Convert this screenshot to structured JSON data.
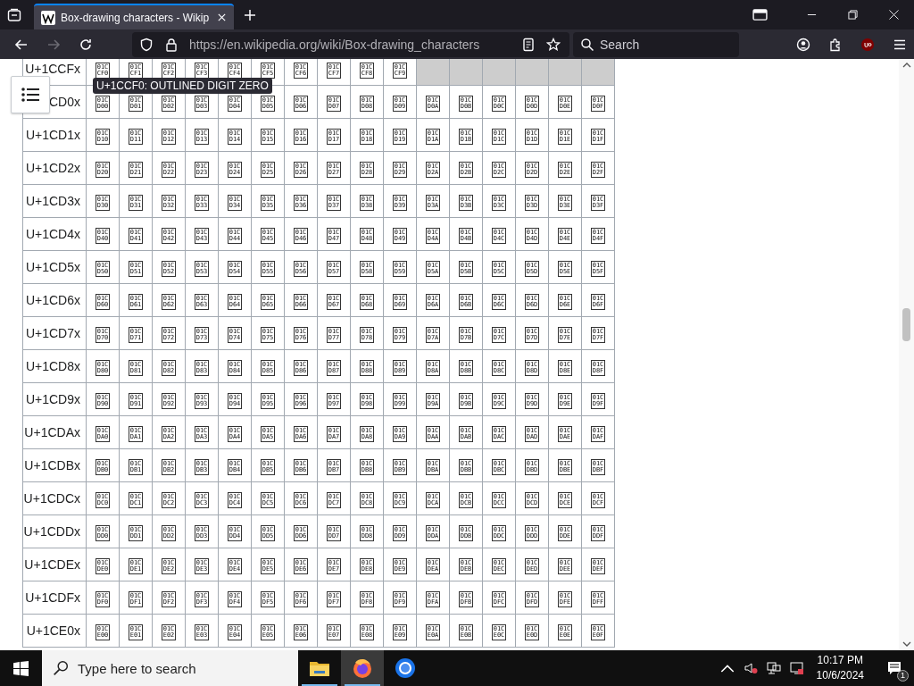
{
  "browser": {
    "tabs": [
      {
        "title": "Box-drawing characters - Wikip",
        "selected": true
      }
    ],
    "nav": [
      {
        "kind": "back",
        "disabled": false
      },
      {
        "kind": "forward",
        "disabled": true
      },
      {
        "kind": "reload",
        "disabled": false
      }
    ],
    "url": "https://en.wikipedia.org/wiki/Box-drawing_characters",
    "search": {
      "placeholder": "Search"
    }
  },
  "table": {
    "rows": [
      {
        "label": "U+1CCFx",
        "cells": [
          "01C\nCF0",
          "01C\nCF1",
          "01C\nCF2",
          "01C\nCF3",
          "01C\nCF4",
          "01C\nCF5",
          "01C\nCF6",
          "01C\nCF7",
          "01C\nCF8",
          "01C\nCF9",
          {
            "kind": "unassigned"
          },
          {
            "kind": "unassigned"
          },
          {
            "kind": "unassigned"
          },
          {
            "kind": "unassigned"
          },
          {
            "kind": "unassigned"
          },
          {
            "kind": "unassigned"
          }
        ]
      },
      {
        "label": "CD0x",
        "cells": [
          "01C\nD00",
          "01C\nD01",
          "01C\nD02",
          "01C\nD03",
          "01C\nD04",
          "01C\nD05",
          "01C\nD06",
          "01C\nD07",
          "01C\nD08",
          "01C\nD09",
          "01C\nD0A",
          "01C\nD0B",
          "01C\nD0C",
          "01C\nD0D",
          "01C\nD0E",
          "01C\nD0F"
        ]
      },
      {
        "label": "U+1CD1x",
        "cells": [
          "01C\nD10",
          "01C\nD11",
          "01C\nD12",
          "01C\nD13",
          "01C\nD14",
          "01C\nD15",
          "01C\nD16",
          "01C\nD17",
          "01C\nD18",
          "01C\nD19",
          "01C\nD1A",
          "01C\nD1B",
          "01C\nD1C",
          "01C\nD1D",
          "01C\nD1E",
          "01C\nD1F"
        ]
      },
      {
        "label": "U+1CD2x",
        "cells": [
          "01C\nD20",
          "01C\nD21",
          "01C\nD22",
          "01C\nD23",
          "01C\nD24",
          "01C\nD25",
          "01C\nD26",
          "01C\nD27",
          "01C\nD28",
          "01C\nD29",
          "01C\nD2A",
          "01C\nD2B",
          "01C\nD2C",
          "01C\nD2D",
          "01C\nD2E",
          "01C\nD2F"
        ]
      },
      {
        "label": "U+1CD3x",
        "cells": [
          "01C\nD30",
          "01C\nD31",
          "01C\nD32",
          "01C\nD33",
          "01C\nD34",
          "01C\nD35",
          "01C\nD36",
          "01C\nD37",
          "01C\nD38",
          "01C\nD39",
          "01C\nD3A",
          "01C\nD3B",
          "01C\nD3C",
          "01C\nD3D",
          "01C\nD3E",
          "01C\nD3F"
        ]
      },
      {
        "label": "U+1CD4x",
        "cells": [
          "01C\nD40",
          "01C\nD41",
          "01C\nD42",
          "01C\nD43",
          "01C\nD44",
          "01C\nD45",
          "01C\nD46",
          "01C\nD47",
          "01C\nD48",
          "01C\nD49",
          "01C\nD4A",
          "01C\nD4B",
          "01C\nD4C",
          "01C\nD4D",
          "01C\nD4E",
          "01C\nD4F"
        ]
      },
      {
        "label": "U+1CD5x",
        "cells": [
          "01C\nD50",
          "01C\nD51",
          "01C\nD52",
          "01C\nD53",
          "01C\nD54",
          "01C\nD55",
          "01C\nD56",
          "01C\nD57",
          "01C\nD58",
          "01C\nD59",
          "01C\nD5A",
          "01C\nD5B",
          "01C\nD5C",
          "01C\nD5D",
          "01C\nD5E",
          "01C\nD5F"
        ]
      },
      {
        "label": "U+1CD6x",
        "cells": [
          "01C\nD60",
          "01C\nD61",
          "01C\nD62",
          "01C\nD63",
          "01C\nD64",
          "01C\nD65",
          "01C\nD66",
          "01C\nD67",
          "01C\nD68",
          "01C\nD69",
          "01C\nD6A",
          "01C\nD6B",
          "01C\nD6C",
          "01C\nD6D",
          "01C\nD6E",
          "01C\nD6F"
        ]
      },
      {
        "label": "U+1CD7x",
        "cells": [
          "01C\nD70",
          "01C\nD71",
          "01C\nD72",
          "01C\nD73",
          "01C\nD74",
          "01C\nD75",
          "01C\nD76",
          "01C\nD77",
          "01C\nD78",
          "01C\nD79",
          "01C\nD7A",
          "01C\nD7B",
          "01C\nD7C",
          "01C\nD7D",
          "01C\nD7E",
          "01C\nD7F"
        ]
      },
      {
        "label": "U+1CD8x",
        "cells": [
          "01C\nD80",
          "01C\nD81",
          "01C\nD82",
          "01C\nD83",
          "01C\nD84",
          "01C\nD85",
          "01C\nD86",
          "01C\nD87",
          "01C\nD88",
          "01C\nD89",
          "01C\nD8A",
          "01C\nD8B",
          "01C\nD8C",
          "01C\nD8D",
          "01C\nD8E",
          "01C\nD8F"
        ]
      },
      {
        "label": "U+1CD9x",
        "cells": [
          "01C\nD90",
          "01C\nD91",
          "01C\nD92",
          "01C\nD93",
          "01C\nD94",
          "01C\nD95",
          "01C\nD96",
          "01C\nD97",
          "01C\nD98",
          "01C\nD99",
          "01C\nD9A",
          "01C\nD9B",
          "01C\nD9C",
          "01C\nD9D",
          "01C\nD9E",
          "01C\nD9F"
        ]
      },
      {
        "label": "U+1CDAx",
        "cells": [
          "01C\nDA0",
          "01C\nDA1",
          "01C\nDA2",
          "01C\nDA3",
          "01C\nDA4",
          "01C\nDA5",
          "01C\nDA6",
          "01C\nDA7",
          "01C\nDA8",
          "01C\nDA9",
          "01C\nDAA",
          "01C\nDAB",
          "01C\nDAC",
          "01C\nDAD",
          "01C\nDAE",
          "01C\nDAF"
        ]
      },
      {
        "label": "U+1CDBx",
        "cells": [
          "01C\nDB0",
          "01C\nDB1",
          "01C\nDB2",
          "01C\nDB3",
          "01C\nDB4",
          "01C\nDB5",
          "01C\nDB6",
          "01C\nDB7",
          "01C\nDB8",
          "01C\nDB9",
          "01C\nDBA",
          "01C\nDBB",
          "01C\nDBC",
          "01C\nDBD",
          "01C\nDBE",
          "01C\nDBF"
        ]
      },
      {
        "label": "U+1CDCx",
        "cells": [
          "01C\nDC0",
          "01C\nDC1",
          "01C\nDC2",
          "01C\nDC3",
          "01C\nDC4",
          "01C\nDC5",
          "01C\nDC6",
          "01C\nDC7",
          "01C\nDC8",
          "01C\nDC9",
          "01C\nDCA",
          "01C\nDCB",
          "01C\nDCC",
          "01C\nDCD",
          "01C\nDCE",
          "01C\nDCF"
        ]
      },
      {
        "label": "U+1CDDx",
        "cells": [
          "01C\nDD0",
          "01C\nDD1",
          "01C\nDD2",
          "01C\nDD3",
          "01C\nDD4",
          "01C\nDD5",
          "01C\nDD6",
          "01C\nDD7",
          "01C\nDD8",
          "01C\nDD9",
          "01C\nDDA",
          "01C\nDDB",
          "01C\nDDC",
          "01C\nDDD",
          "01C\nDDE",
          "01C\nDDF"
        ]
      },
      {
        "label": "U+1CDEx",
        "cells": [
          "01C\nDE0",
          "01C\nDE1",
          "01C\nDE2",
          "01C\nDE3",
          "01C\nDE4",
          "01C\nDE5",
          "01C\nDE6",
          "01C\nDE7",
          "01C\nDE8",
          "01C\nDE9",
          "01C\nDEA",
          "01C\nDEB",
          "01C\nDEC",
          "01C\nDED",
          "01C\nDEE",
          "01C\nDEF"
        ]
      },
      {
        "label": "U+1CDFx",
        "cells": [
          "01C\nDF0",
          "01C\nDF1",
          "01C\nDF2",
          "01C\nDF3",
          "01C\nDF4",
          "01C\nDF5",
          "01C\nDF6",
          "01C\nDF7",
          "01C\nDF8",
          "01C\nDF9",
          "01C\nDFA",
          "01C\nDFB",
          "01C\nDFC",
          "01C\nDFD",
          "01C\nDFE",
          "01C\nDFF"
        ]
      },
      {
        "label": "U+1CE0x",
        "cells": [
          "01C\nE00",
          "01C\nE01",
          "01C\nE02",
          "01C\nE03",
          "01C\nE04",
          "01C\nE05",
          "01C\nE06",
          "01C\nE07",
          "01C\nE08",
          "01C\nE09",
          "01C\nE0A",
          "01C\nE0B",
          "01C\nE0C",
          "01C\nE0D",
          "01C\nE0E",
          "01C\nE0F"
        ]
      }
    ]
  },
  "tooltip": "U+1CCF0: OUTLINED DIGIT ZERO",
  "taskbar": {
    "search": {
      "placeholder": "Type here to search"
    },
    "apps": [
      {
        "kind": "files",
        "selected": false,
        "running": true
      },
      {
        "kind": "firefox",
        "selected": true,
        "running": true
      },
      {
        "kind": "chrome",
        "selected": false,
        "running": false
      }
    ],
    "time": "10:17 PM",
    "date": "10/6/2024",
    "notifications": "1"
  }
}
